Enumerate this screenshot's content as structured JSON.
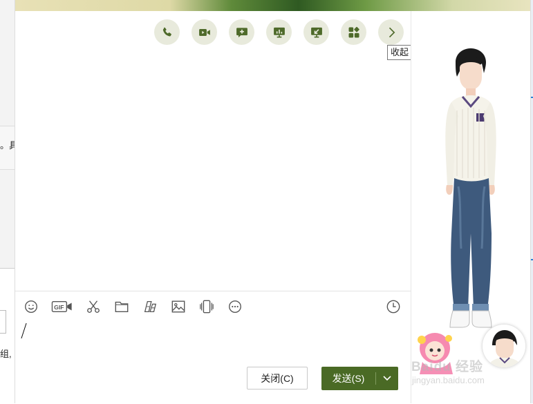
{
  "background": {
    "frag_top": "。具",
    "frag_bottom": "组,"
  },
  "toolbar": {
    "items": [
      {
        "icon": "phone-icon",
        "label": "语音通话"
      },
      {
        "icon": "video-icon",
        "label": "视频通话"
      },
      {
        "icon": "chat-add-icon",
        "label": "发起多人聊天"
      },
      {
        "icon": "screen-share-icon",
        "label": "演示"
      },
      {
        "icon": "remote-assist-icon",
        "label": "远程协助"
      },
      {
        "icon": "apps-icon",
        "label": "应用"
      },
      {
        "icon": "chevron-right-icon",
        "label": "收起"
      }
    ],
    "tooltip": "收起"
  },
  "input_toolbar": {
    "items": [
      "emoji-icon",
      "gif-icon",
      "screenshot-scissors-icon",
      "folder-icon",
      "fonts-icon",
      "image-icon",
      "shake-icon",
      "more-icon"
    ],
    "history_icon": "clock-icon"
  },
  "buttons": {
    "close": "关闭(C)",
    "send": "发送(S)"
  },
  "watermark": {
    "line1": "Baidu 经验",
    "line2": "jingyan.baidu.com"
  },
  "colors": {
    "accent": "#4a6a25",
    "toolbar_button_bg": "#e8eadc",
    "icon": "#4e6a2a"
  }
}
